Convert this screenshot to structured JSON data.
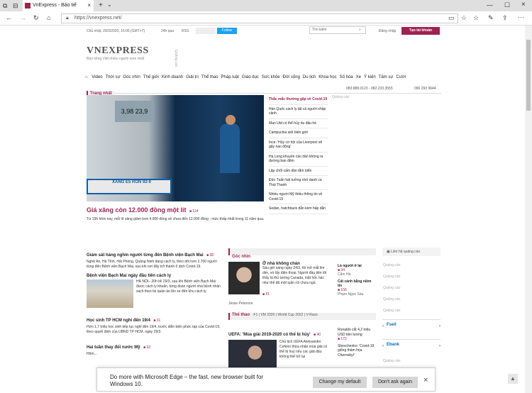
{
  "browser": {
    "tab_title": "VnExpress - Báo tiế",
    "tab_close": "×",
    "new_tab": "+",
    "url": "https://vnexpress.net/",
    "controls": {
      "minimize": "—",
      "maximize": "☐",
      "close": "×"
    }
  },
  "topbar": {
    "date": "Chủ nhật, 29/3/2020, 16:06 (GMT+7)",
    "latest": "24h qua",
    "rss": "RSS",
    "follow": "Follow",
    "search_placeholder": "Tìm kiếm",
    "login": "Đăng nhập",
    "signup": "Tạo tài khoản"
  },
  "logo": {
    "text": "VNEXPRESS",
    "tagline": "Báo tiếng Việt nhiều người xem nhất",
    "ad_label": "Quảng cáo"
  },
  "nav": [
    "Video",
    "Thời sự",
    "Góc nhìn",
    "Thế giới",
    "Kinh doanh",
    "Giải trí",
    "Thể thao",
    "Pháp luật",
    "Giáo dục",
    "Sức khỏe",
    "Đời sống",
    "Du lịch",
    "Khoa học",
    "Số hóa",
    "Xe",
    "Ý kiến",
    "Tâm sự",
    "Cười"
  ],
  "featured": {
    "section": "Trang nhất",
    "hotline1": "083.888.0123 - 082.233.3555",
    "hotline2": "090 293 9644",
    "ad_label": "Quảng cáo",
    "title": "Giá xăng còn 12.000 đồng một lít",
    "comments": "114",
    "summary": "Từ 15h hôm nay, mỗi lít xăng giảm hơn 4.000 đồng về chưa đến 12.000 đồng - mức thấp nhất trong 11 năm qua.",
    "pump_label": "XĂNG E5 RON 92-II",
    "pump_display": "3,98 23,9"
  },
  "sidebar_list": [
    {
      "title": "Thắc mắc thường gặp về Covid-19",
      "highlight": true
    },
    {
      "title": "Hàn Quốc cách ly tất cả người nhập cảnh"
    },
    {
      "title": "Man Utd có thể hủy du đấu hè"
    },
    {
      "title": "Campuchia siết biên giới"
    },
    {
      "title": "Ince: 'Hủy cơ hội của Liverpool sẽ gây náo động'"
    },
    {
      "title": "Hạ Long khuyến cáo dân không ra đường ban đêm"
    },
    {
      "title": "Lập chốt cấm dân tắm biển"
    },
    {
      "title": "Đức Tuấn hát tưởng nhớ danh ca Thái Thanh"
    },
    {
      "title": "Nhiều người Mỹ thiếu thông tin về Covid-19"
    },
    {
      "title": "Sedan, hatchback dẫn kèm hấp dẫn"
    }
  ],
  "news": [
    {
      "title": "Giám sát hàng nghìn người từng đến Bệnh viện Bạch Mai",
      "comments": "38",
      "summary": "Nghệ An, Hà Tĩnh, Hải Phòng, Quảng Ninh đang cách ly, theo dõi hơn 2.700 người từng đến Bệnh viện Bạch Mai, sau khi nơi đây trở thành ổ dịch Covid-19."
    },
    {
      "title": "Bệnh viện Bạch Mai ngày đầu tiên cách ly",
      "comments": "",
      "summary": "HÀ NỘI– 20h tối 29/3, sau khi Bệnh viện Bạch Mai được cách ly khuẩn, từng đoàn người nhà bệnh nhân xách theo túi quần áo lên xe đến khu cách ly."
    },
    {
      "title": "Học sinh TP HCM nghỉ đến 19/4",
      "comments": "31",
      "summary": "Hơn 1,7 triệu học sinh tiếp tục nghỉ đến 19/4, trước diễn biến phức tạp của Covid-19, theo quyết định của UBND TP HCM, ngày 29/3."
    },
    {
      "title": "Hai tuần thay đổi nước Mỹ",
      "comments": "33",
      "summary": "Hôm..."
    }
  ],
  "opinion": {
    "section": "Góc nhìn",
    "title": "Ở nhà không chán",
    "summary": "Sáu giờ sáng ngày 24/3, tôi mở mắt lim dim, vớ lấy điện thoại. Người đầu tiên tôi thấy là thủ tướng Canada, mặt hốc hác như thể đã một tuần rồi chưa ngủ.",
    "author": "Jesse Peterson",
    "comments": "41",
    "side": [
      {
        "title": "Là người ở lại",
        "comments": "34",
        "author": "Cẩm Hà"
      },
      {
        "title": "Cất cánh bằng niềm tin",
        "comments": "156",
        "author": "Phạm Ngọc Sáu"
      }
    ]
  },
  "sports": {
    "section": "Thể thao",
    "tabs": [
      "F1",
      "VM 2020",
      "World Cup 2022",
      "V-Race"
    ],
    "title": "UEFA: 'Mùa giải 2019-2020 có thể bị hủy'",
    "comments": "40",
    "summary": "Chủ tịch UEFA Aleksander Ceferin thừa nhận mùa giải có thể bị huỷ nếu các giải đấu không thể trở lại",
    "side": [
      {
        "title": "Ronaldo cắt 4,2 triệu USD tiền lương",
        "comments": "172"
      },
      {
        "title": "Shevchenko: 'Covid-19 giống thảm họa Chernobyl'"
      }
    ]
  },
  "right_ads": {
    "contact": "Liên hệ quảng cáo",
    "ad_label": "Quảng cáo",
    "bank1": "Fseil",
    "bank2": "Ebank"
  },
  "edge_banner": {
    "message": "Do more with Microsoft Edge – the fast, new browser built for Windows 10.",
    "primary": "Change my default",
    "secondary": "Don't ask again",
    "close": "×"
  }
}
